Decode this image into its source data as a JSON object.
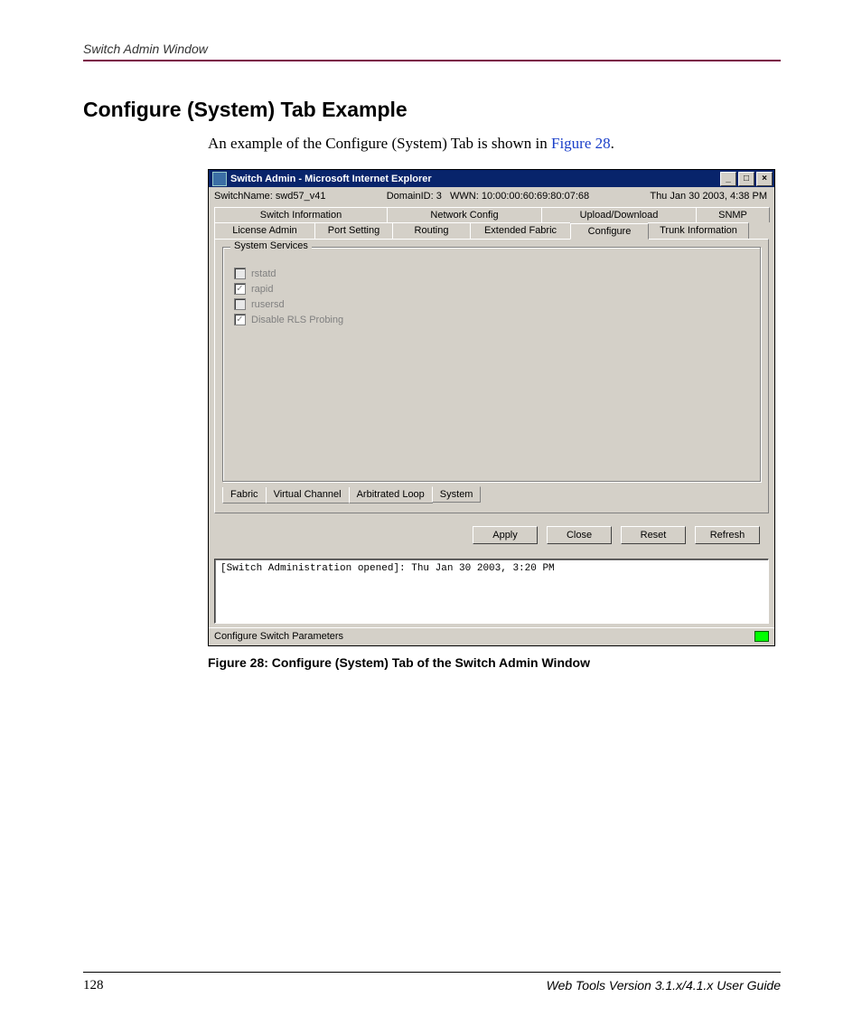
{
  "header": {
    "running": "Switch Admin Window"
  },
  "title": "Configure (System) Tab Example",
  "intro": {
    "pre": "An example of the Configure (System) Tab is shown in ",
    "link": "Figure 28",
    "post": "."
  },
  "window": {
    "title": "Switch Admin - Microsoft Internet Explorer",
    "info": {
      "switch_label": "SwitchName:",
      "switch_name": "swd57_v41",
      "domain": "DomainID: 3",
      "wwn": "WWN: 10:00:00:60:69:80:07:68",
      "time": "Thu Jan 30  2003, 4:38 PM"
    },
    "tabs_top": [
      "Switch Information",
      "Network Config",
      "Upload/Download",
      "SNMP"
    ],
    "tabs_bot": [
      "License Admin",
      "Port Setting",
      "Routing",
      "Extended Fabric",
      "Configure",
      "Trunk Information"
    ],
    "group_title": "System Services",
    "checks": [
      {
        "label": "rstatd",
        "checked": false
      },
      {
        "label": "rapid",
        "checked": true
      },
      {
        "label": "rusersd",
        "checked": false
      },
      {
        "label": "Disable RLS Probing",
        "checked": true
      }
    ],
    "subtabs": [
      "Fabric",
      "Virtual Channel",
      "Arbitrated Loop",
      "System"
    ],
    "buttons": {
      "apply": "Apply",
      "close": "Close",
      "reset": "Reset",
      "refresh": "Refresh"
    },
    "log": "[Switch Administration opened]: Thu Jan 30  2003, 3:20 PM",
    "status": "Configure Switch Parameters"
  },
  "caption": "Figure 28:  Configure (System) Tab of the Switch Admin Window",
  "footer": {
    "page": "128",
    "guide": "Web Tools Version 3.1.x/4.1.x User Guide"
  }
}
